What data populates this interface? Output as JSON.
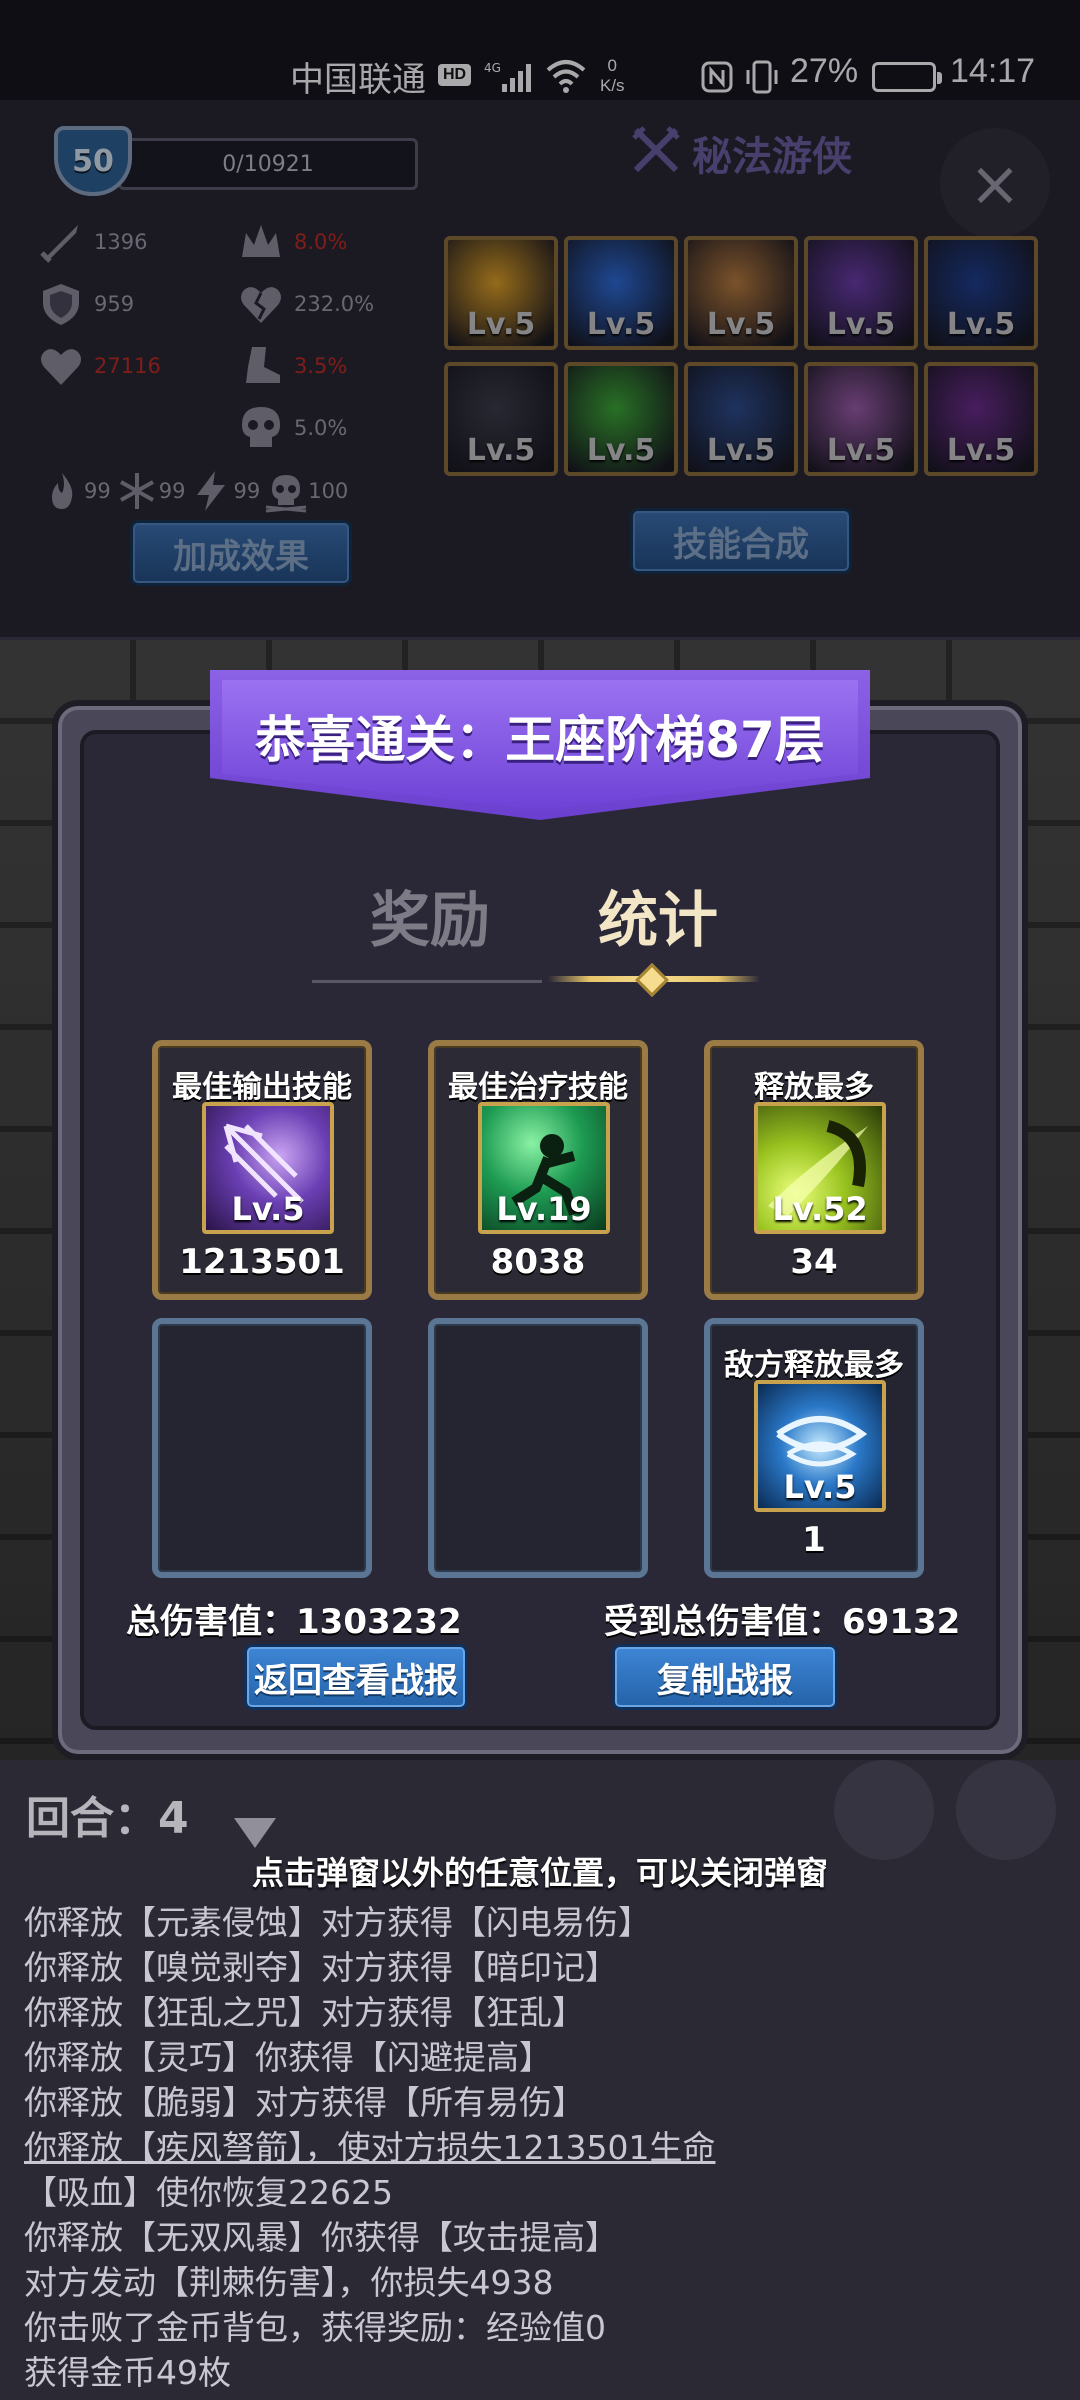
{
  "status_bar": {
    "carrier": "中国联通",
    "hd": "HD",
    "network": "4G",
    "speed_value": "0",
    "speed_unit": "K/s",
    "battery": "27%",
    "time": "14:17"
  },
  "character": {
    "level": "50",
    "exp": "0/10921",
    "class_name": "秘法游侠",
    "close_label": "×",
    "stats_left": [
      {
        "icon": "sword-icon",
        "value": "1396"
      },
      {
        "icon": "shield-icon",
        "value": "959"
      },
      {
        "icon": "heart-icon",
        "value": "27116",
        "red": true
      }
    ],
    "stats_right": [
      {
        "icon": "crown-icon",
        "value": "8.0%",
        "red": true
      },
      {
        "icon": "broken-heart-icon",
        "value": "232.0%"
      },
      {
        "icon": "boot-icon",
        "value": "3.5%",
        "red": true
      },
      {
        "icon": "skull-icon",
        "value": "5.0%"
      }
    ],
    "elements": [
      {
        "icon": "fire-icon",
        "value": "99"
      },
      {
        "icon": "snowflake-icon",
        "value": "99"
      },
      {
        "icon": "lightning-icon",
        "value": "99"
      },
      {
        "icon": "poison-skull-icon",
        "value": "100"
      }
    ],
    "bonus_button": "加成效果",
    "combine_button": "技能合成",
    "skills_row1": [
      "Lv.5",
      "Lv.5",
      "Lv.5",
      "Lv.5",
      "Lv.5"
    ],
    "skills_row2": [
      "Lv.5",
      "Lv.5",
      "Lv.5",
      "Lv.5",
      "Lv.5"
    ],
    "skill_colors": [
      "#e0a022",
      "#2a6ad8",
      "#b87a3a",
      "#6a3aa8",
      "#1c3c8c",
      "#3a3a46",
      "#3aa832",
      "#2a4a8a",
      "#9a5aa8",
      "#6a2a8a"
    ]
  },
  "modal": {
    "title": "恭喜通关：王座阶梯87层",
    "tab_rewards": "奖励",
    "tab_stats": "统计",
    "cards": [
      {
        "title": "最佳输出技能",
        "lv": "Lv.5",
        "value": "1213501",
        "color": "#6b3fb4"
      },
      {
        "title": "最佳治疗技能",
        "lv": "Lv.19",
        "value": "8038",
        "color": "#1d9a52"
      },
      {
        "title": "释放最多",
        "lv": "Lv.52",
        "value": "34",
        "color": "#9ac420"
      },
      {
        "title": "敌方释放最多",
        "lv": "Lv.5",
        "value": "1",
        "color": "#2a78c8"
      }
    ],
    "total_damage": "总伤害值：1303232",
    "total_taken": "受到总伤害值：69132",
    "back_button": "返回查看战报",
    "copy_button": "复制战报"
  },
  "battle_log": {
    "round": "回合：4",
    "hint": "点击弹窗以外的任意位置，可以关闭弹窗",
    "lines": [
      "你释放【元素侵蚀】对方获得【闪电易伤】",
      "你释放【嗅觉剥夺】对方获得【暗印记】",
      "你释放【狂乱之咒】对方获得【狂乱】",
      "你释放【灵巧】你获得【闪避提高】",
      "你释放【脆弱】对方获得【所有易伤】",
      "你释放【疾风弩箭】，使对方损失1213501生命",
      "【吸血】使你恢复22625",
      "你释放【无双风暴】你获得【攻击提高】",
      "对方发动【荆棘伤害】，你损失4938",
      "你击败了金币背包，获得奖励：经验值0",
      "获得金币49枚"
    ]
  }
}
